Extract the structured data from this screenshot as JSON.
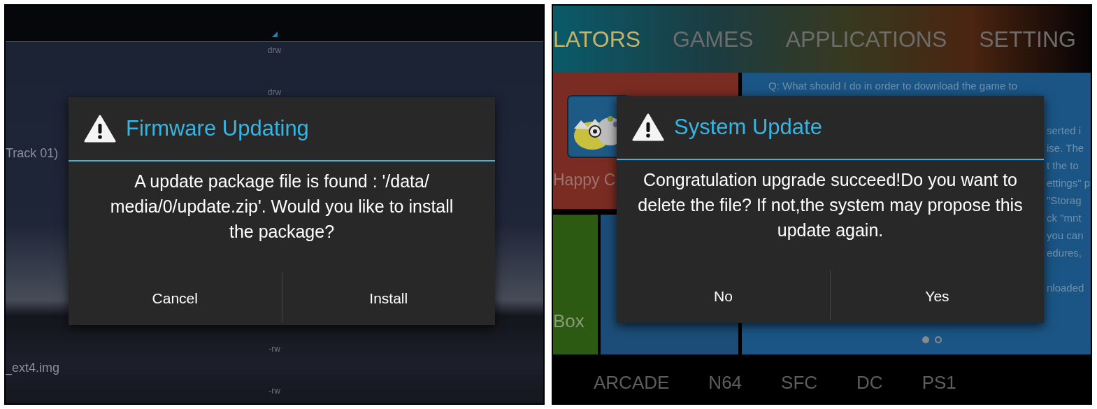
{
  "left_screen": {
    "file_list": [
      {
        "permissions": "drw"
      },
      {
        "permissions": "drw"
      },
      {
        "name": "Track 01)"
      },
      {
        "permissions": "-rw",
        "name": "_ext4.img"
      },
      {
        "permissions": "-rw"
      }
    ],
    "dialog": {
      "title": "Firmware Updating",
      "message": "A update package file is found : '/data/ media/0/update.zip'. Would you like to install the package?",
      "buttons": [
        "Cancel",
        "Install"
      ]
    }
  },
  "right_screen": {
    "top_tabs": [
      {
        "label": "LATORS",
        "selected": true
      },
      {
        "label": "GAMES",
        "selected": false
      },
      {
        "label": "APPLICATIONS",
        "selected": false
      },
      {
        "label": "SETTING",
        "selected": false
      }
    ],
    "tiles": [
      {
        "label": "Happy C"
      },
      {
        "label": "Box"
      }
    ],
    "faq_lines": [
      "Q: What should I do in order to download the game to",
      "serted i",
      "ise. The",
      "t the to",
      "ettings\" p",
      "\"Storag",
      "ck \"mnt",
      "you can",
      "edures,",
      "nloaded"
    ],
    "page_dots": [
      {
        "selected": true
      },
      {
        "selected": false
      }
    ],
    "bottom_tabs": [
      "ARCADE",
      "N64",
      "SFC",
      "DC",
      "PS1"
    ],
    "dialog": {
      "title": "System Update",
      "message": "Congratulation upgrade succeed!Do you want to delete the file? If not,the system may propose this update again.",
      "buttons": [
        "No",
        "Yes"
      ]
    }
  }
}
